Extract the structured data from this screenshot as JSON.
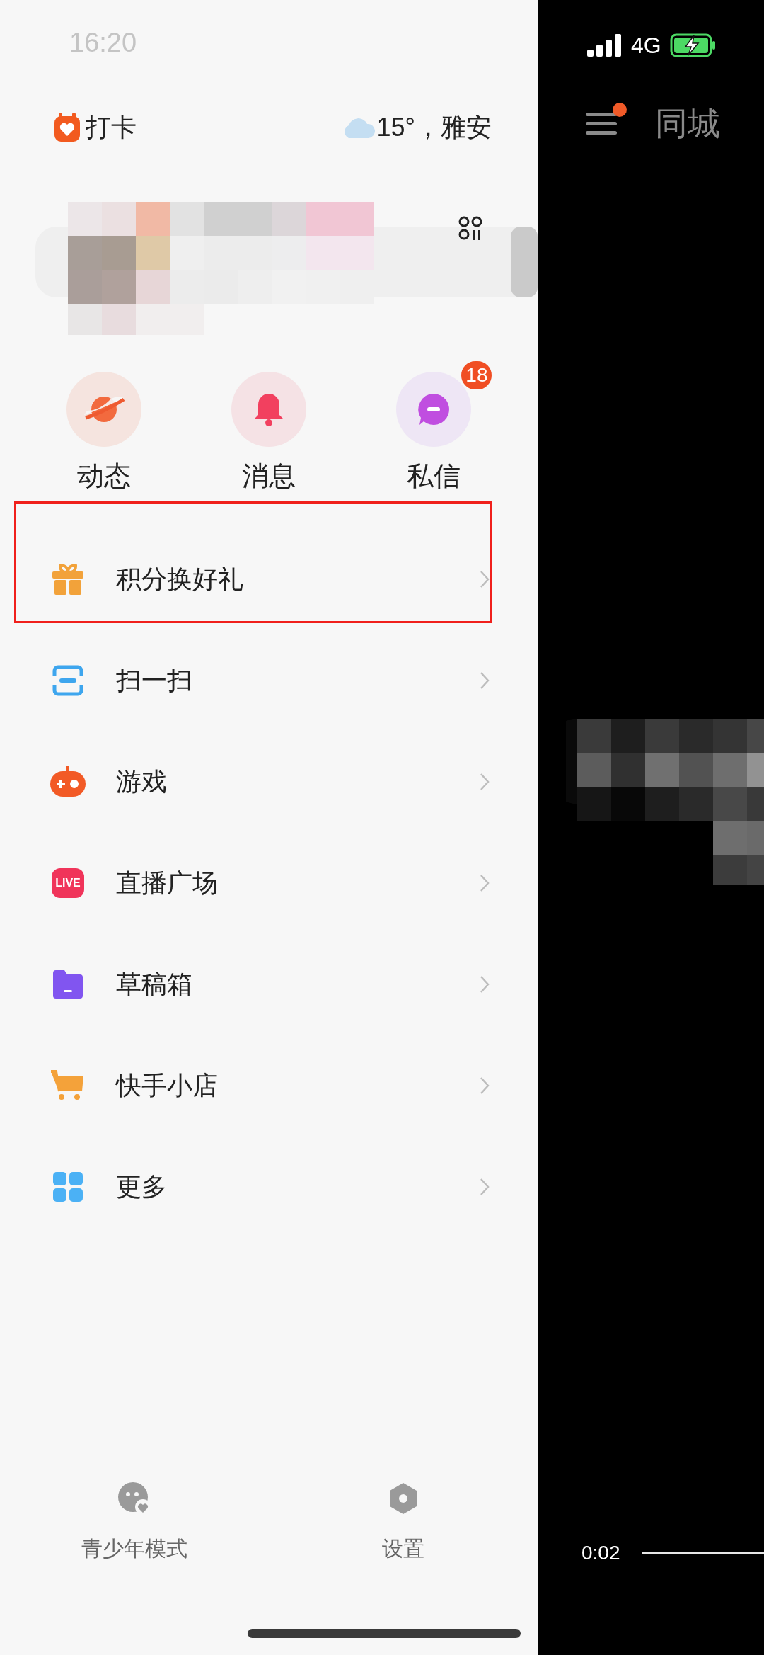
{
  "status_bar": {
    "time": "16:20",
    "network": "4G"
  },
  "header": {
    "checkin": "打卡",
    "weather": "15°，雅安"
  },
  "shortcuts": [
    {
      "label": "动态",
      "kind": "planet"
    },
    {
      "label": "消息",
      "kind": "bell"
    },
    {
      "label": "私信",
      "kind": "chat",
      "badge": "18"
    }
  ],
  "menu": [
    {
      "label": "积分换好礼",
      "kind": "gift",
      "highlighted": true
    },
    {
      "label": "扫一扫",
      "kind": "scan",
      "highlighted": false
    },
    {
      "label": "游戏",
      "kind": "game",
      "highlighted": false
    },
    {
      "label": "直播广场",
      "kind": "live",
      "icon_text": "LIVE",
      "highlighted": false
    },
    {
      "label": "草稿箱",
      "kind": "folder",
      "highlighted": false
    },
    {
      "label": "快手小店",
      "kind": "cart",
      "highlighted": false
    },
    {
      "label": "更多",
      "kind": "grid",
      "highlighted": false
    }
  ],
  "footer": [
    {
      "label": "青少年模式",
      "kind": "teen"
    },
    {
      "label": "设置",
      "kind": "settings"
    }
  ],
  "video": {
    "tab": "同城",
    "menu_has_dot": true,
    "elapsed": "0:02"
  }
}
